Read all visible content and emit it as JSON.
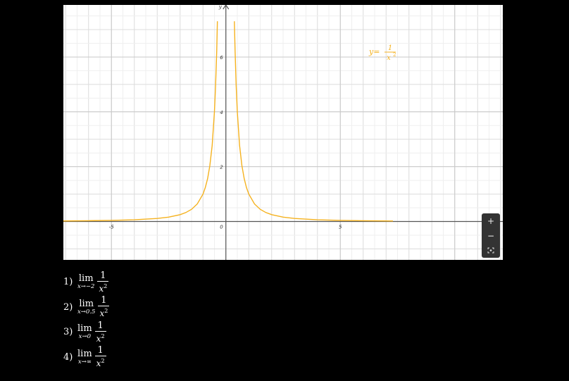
{
  "chart_data": {
    "type": "line",
    "function": "1/x^2",
    "series": [
      {
        "color": "#f5b21f",
        "x": [
          -7.3,
          -6,
          -5,
          -4,
          -3,
          -2.5,
          -2,
          -1.75,
          -1.5,
          -1.25,
          -1,
          -0.9,
          -0.8,
          -0.7,
          -0.6,
          -0.5,
          -0.45,
          -0.4,
          -0.37,
          0.37,
          0.4,
          0.45,
          0.5,
          0.6,
          0.7,
          0.8,
          0.9,
          1,
          1.25,
          1.5,
          1.75,
          2,
          2.5,
          3,
          4,
          5,
          6,
          7.3
        ],
        "y": [
          0.019,
          0.028,
          0.04,
          0.063,
          0.111,
          0.16,
          0.25,
          0.327,
          0.444,
          0.64,
          1,
          1.235,
          1.563,
          2.041,
          2.778,
          4,
          4.938,
          6.25,
          7.305,
          7.305,
          6.25,
          4.938,
          4,
          2.778,
          2.041,
          1.563,
          1.235,
          1,
          0.64,
          0.444,
          0.327,
          0.25,
          0.16,
          0.111,
          0.063,
          0.04,
          0.028,
          0.019
        ]
      }
    ],
    "xlim": [
      -7.1,
      12.1
    ],
    "ylim": [
      -1.4,
      7.9
    ],
    "x_ticks": [
      {
        "value": -5,
        "label": "-5"
      },
      {
        "value": 5,
        "label": "5"
      }
    ],
    "y_ticks": [
      {
        "value": 2,
        "label": "2"
      },
      {
        "value": 4,
        "label": "4"
      },
      {
        "value": 6,
        "label": "6"
      }
    ],
    "origin_label": "0",
    "xlabel": "x",
    "ylabel": "y",
    "grid": true,
    "annotation": {
      "text_left": "y=",
      "numerator": "1",
      "denominator": "x",
      "exponent": "2"
    }
  },
  "toolbar": {
    "icons": [
      "play-icon",
      "share-icon",
      "graph-settings-icon"
    ]
  },
  "zoom": {
    "plus": "+",
    "minus": "−",
    "fit_icon": "fit-to-screen-icon"
  },
  "limits": [
    {
      "index": "1)",
      "op": "lim",
      "sub": "x→−2",
      "num": "1",
      "den": "x",
      "exp": "2"
    },
    {
      "index": "2)",
      "op": "lim",
      "sub": "x→0.5",
      "num": "1",
      "den": "x",
      "exp": "2"
    },
    {
      "index": "3)",
      "op": "lim",
      "sub": "x→0",
      "num": "1",
      "den": "x",
      "exp": "2"
    },
    {
      "index": "4)",
      "op": "lim",
      "sub": "x→∞",
      "num": "1",
      "den": "x",
      "exp": "2"
    }
  ]
}
